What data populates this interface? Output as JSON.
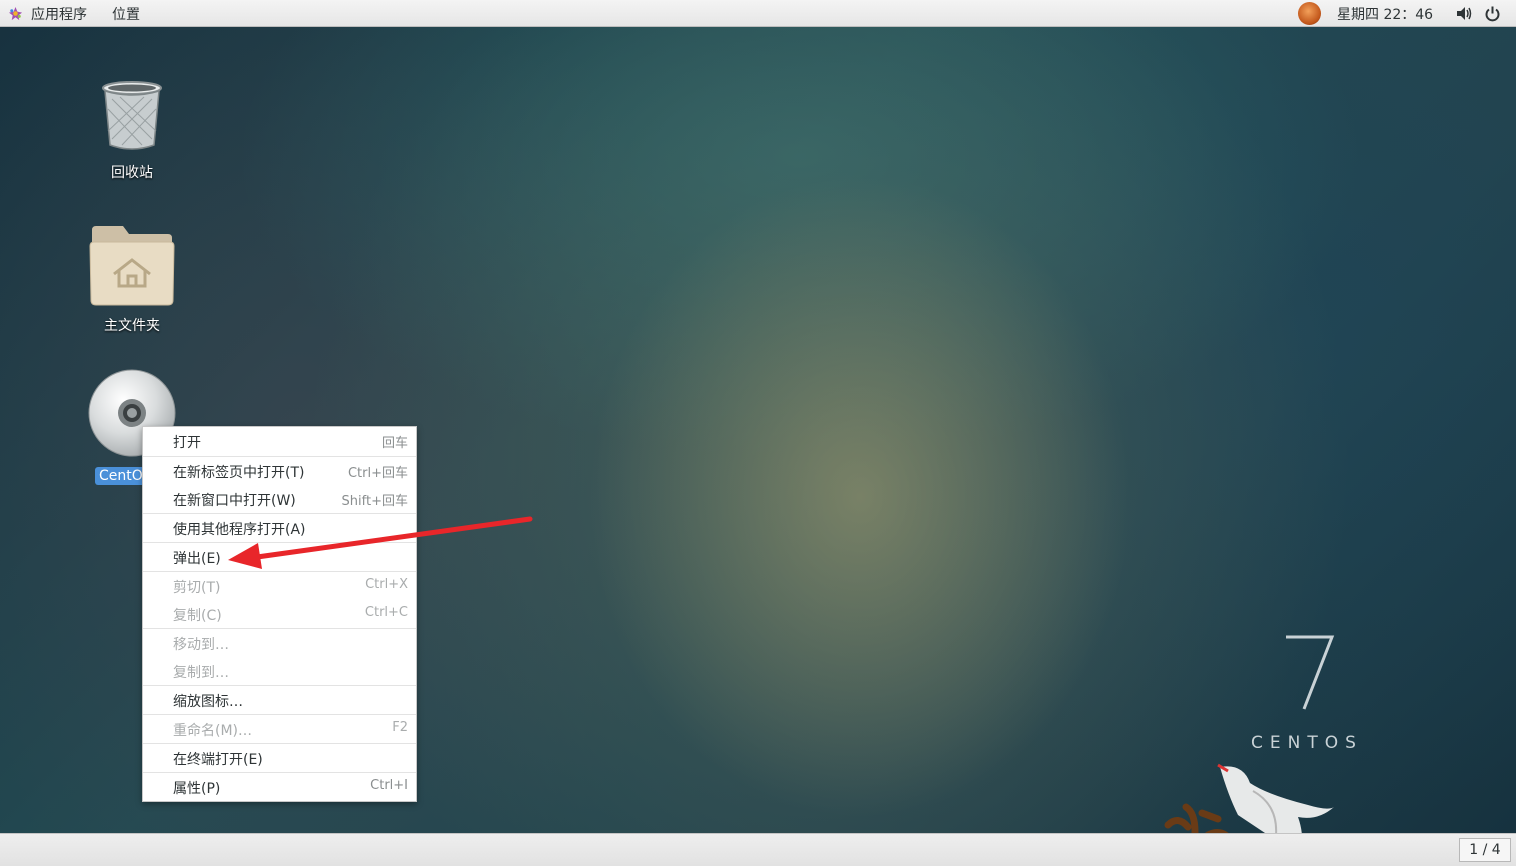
{
  "topbar": {
    "applications_label": "应用程序",
    "places_label": "位置",
    "clock": "星期四 22：46"
  },
  "desktop": {
    "icons": [
      {
        "label": "回收站",
        "icon": "trash-icon"
      },
      {
        "label": "主文件夹",
        "icon": "home-folder-icon"
      },
      {
        "label": "CentOS 7",
        "icon": "cd-icon"
      }
    ],
    "logo_number": "7",
    "logo_word": "CENTOS"
  },
  "context_menu": {
    "items": [
      {
        "label": "打开",
        "shortcut": "回车",
        "enabled": true
      },
      {
        "label": "在新标签页中打开(T)",
        "shortcut": "Ctrl+回车",
        "enabled": true
      },
      {
        "label": "在新窗口中打开(W)",
        "shortcut": "Shift+回车",
        "enabled": true
      },
      {
        "label": "使用其他程序打开(A)",
        "shortcut": "",
        "enabled": true
      },
      {
        "label": "弹出(E)",
        "shortcut": "",
        "enabled": true
      },
      {
        "label": "剪切(T)",
        "shortcut": "Ctrl+X",
        "enabled": false
      },
      {
        "label": "复制(C)",
        "shortcut": "Ctrl+C",
        "enabled": false
      },
      {
        "label": "移动到…",
        "shortcut": "",
        "enabled": false
      },
      {
        "label": "复制到…",
        "shortcut": "",
        "enabled": false
      },
      {
        "label": "缩放图标…",
        "shortcut": "",
        "enabled": true
      },
      {
        "label": "重命名(M)…",
        "shortcut": "F2",
        "enabled": false
      },
      {
        "label": "在终端打开(E)",
        "shortcut": "",
        "enabled": true
      },
      {
        "label": "属性(P)",
        "shortcut": "Ctrl+I",
        "enabled": true
      }
    ]
  },
  "bottombar": {
    "workspace": "1 / 4"
  },
  "annotation": {
    "arrow_color": "#e8262a"
  }
}
